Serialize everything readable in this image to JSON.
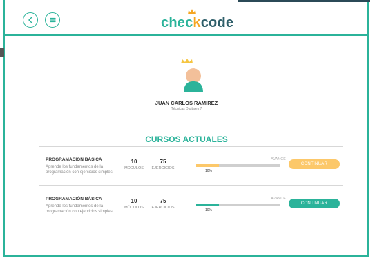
{
  "header": {
    "logo_text_a": "chec",
    "logo_text_b": "k",
    "logo_text_c": "code"
  },
  "user": {
    "name": "JUAN CARLOS  RAMIREZ",
    "role": "Técnicas Digitales 7"
  },
  "section_title": "CURSOS ACTUALES",
  "courses": [
    {
      "title": "PROGRAMACIÓN BÁSICA",
      "description": "Aprende los fundamentos de la programación con ejercicios simples.",
      "modules_value": "10",
      "modules_label": "MÓDULOS",
      "exercises_value": "75",
      "exercises_label": "EJERCICIOS",
      "progress_label": "AVANCE",
      "progress_percent_text": "10%",
      "progress_fraction": 0.27,
      "button_label": "CONTINUAR",
      "bar_color": "#fcc86a",
      "button_color": "#fcc86a"
    },
    {
      "title": "PROGRAMACIÓN BÁSICA",
      "description": "Aprende los fundamentos de la programación con ejercicios simples.",
      "modules_value": "10",
      "modules_label": "MÓDULOS",
      "exercises_value": "75",
      "exercises_label": "EJERCICIOS",
      "progress_label": "AVANCE",
      "progress_percent_text": "10%",
      "progress_fraction": 0.27,
      "button_label": "CONTINUAR",
      "bar_color": "#2bb39a",
      "button_color": "#2bb39a"
    }
  ],
  "colors": {
    "accent": "#2bb39a",
    "brand_orange": "#f5a623"
  }
}
